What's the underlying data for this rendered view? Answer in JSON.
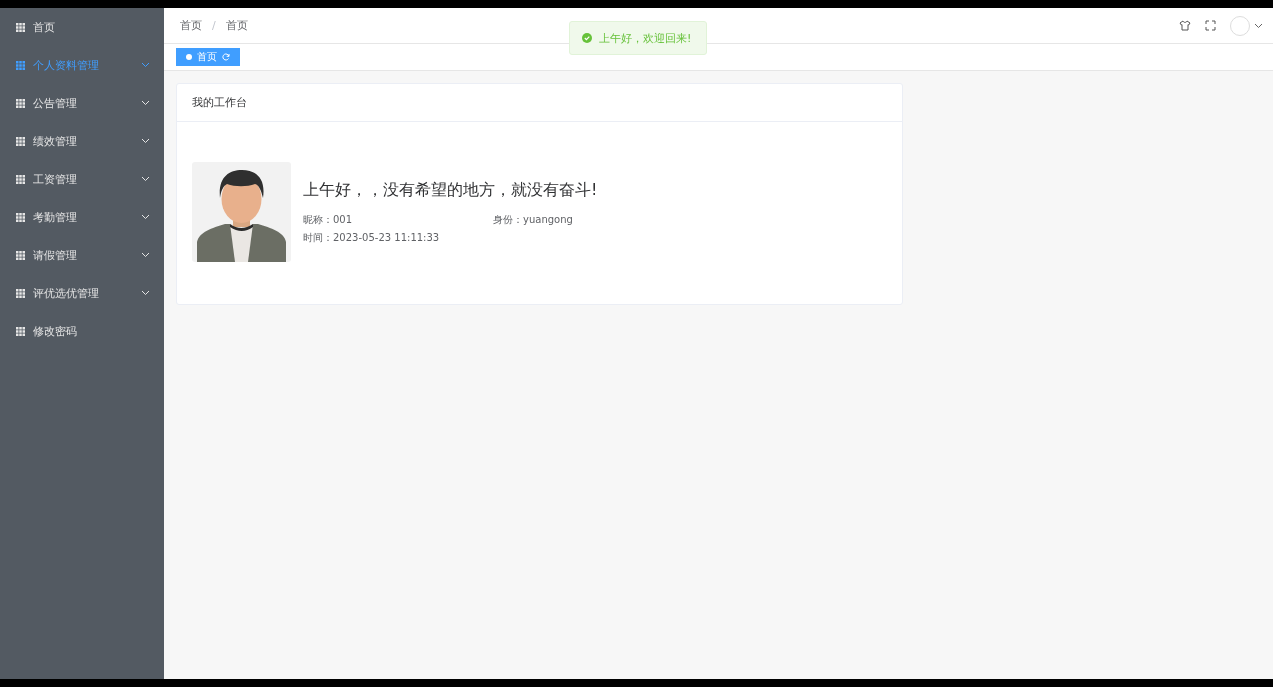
{
  "sidebar": {
    "items": [
      {
        "label": "首页",
        "kind": "item",
        "selected": false
      },
      {
        "label": "个人资料管理",
        "kind": "submenu",
        "selected": true
      },
      {
        "label": "公告管理",
        "kind": "submenu",
        "selected": false
      },
      {
        "label": "绩效管理",
        "kind": "submenu",
        "selected": false
      },
      {
        "label": "工资管理",
        "kind": "submenu",
        "selected": false
      },
      {
        "label": "考勤管理",
        "kind": "submenu",
        "selected": false
      },
      {
        "label": "请假管理",
        "kind": "submenu",
        "selected": false
      },
      {
        "label": "评优选优管理",
        "kind": "submenu",
        "selected": false
      },
      {
        "label": "修改密码",
        "kind": "item",
        "selected": false
      }
    ]
  },
  "header": {
    "breadcrumb": [
      "首页",
      "首页"
    ],
    "separator": "/"
  },
  "toast": {
    "message": "上午好，欢迎回来!"
  },
  "tags": [
    {
      "label": "首页",
      "selected": true
    }
  ],
  "card": {
    "title": "我的工作台",
    "greeting": "上午好，，没有希望的地方，就没有奋斗!",
    "fields": [
      {
        "label": "昵称：",
        "value": "001"
      },
      {
        "label": "身份：",
        "value": "yuangong"
      },
      {
        "label": "时间：",
        "value": "2023-05-23 11:11:33"
      }
    ]
  }
}
